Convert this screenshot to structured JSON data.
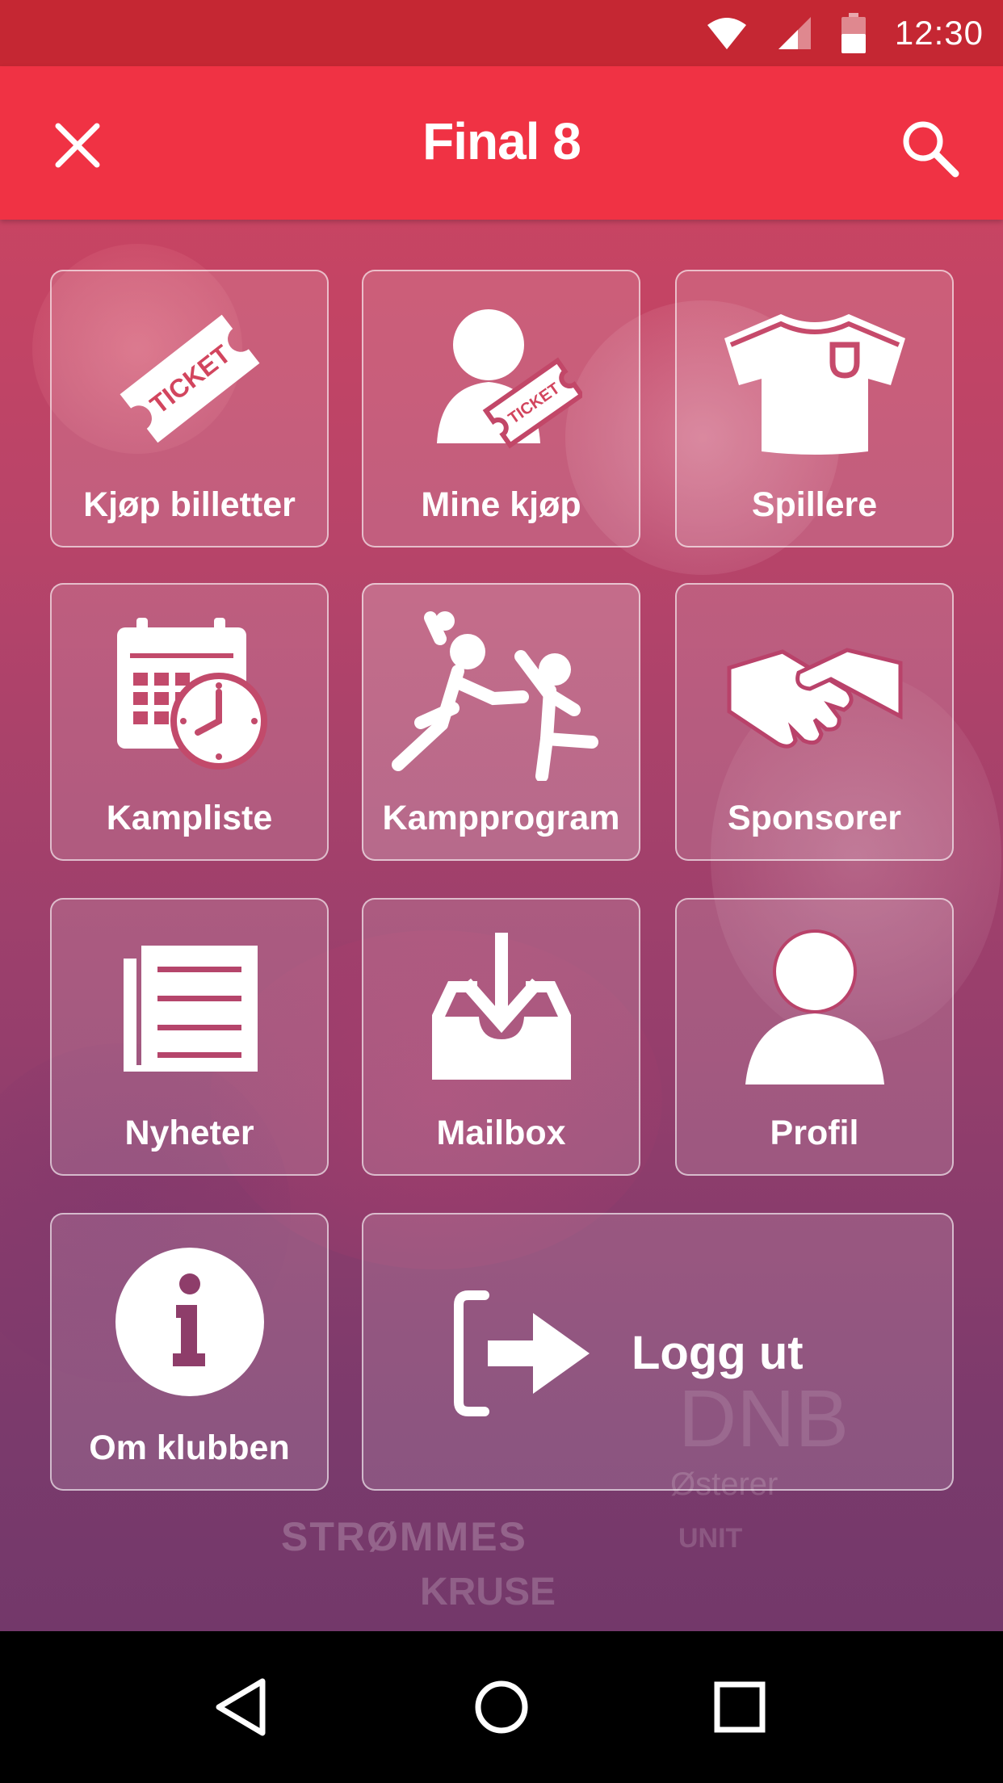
{
  "status_bar": {
    "time": "12:30",
    "icons": [
      "wifi-icon",
      "cellular-signal-icon",
      "battery-icon"
    ]
  },
  "app_bar": {
    "title": "Final 8",
    "close_icon": "close-icon",
    "search_icon": "search-icon"
  },
  "menu": [
    {
      "label": "Kjøp billetter",
      "icon": "ticket-icon",
      "icon_text": "TICKET"
    },
    {
      "label": "Mine kjøp",
      "icon": "user-ticket-icon",
      "icon_text": "TICKET"
    },
    {
      "label": "Spillere",
      "icon": "jersey-icon"
    },
    {
      "label": "Kampliste",
      "icon": "calendar-clock-icon"
    },
    {
      "label": "Kampprogram",
      "icon": "handball-players-icon"
    },
    {
      "label": "Sponsorer",
      "icon": "handshake-icon"
    },
    {
      "label": "Nyheter",
      "icon": "newspaper-icon"
    },
    {
      "label": "Mailbox",
      "icon": "inbox-download-icon"
    },
    {
      "label": "Profil",
      "icon": "person-icon"
    },
    {
      "label": "Om klubben",
      "icon": "info-icon"
    },
    {
      "label": "Logg ut",
      "icon": "logout-icon"
    }
  ],
  "background_text": [
    "STRØMMES",
    "KRUSE",
    "DNB",
    "Østerer",
    "UNIT"
  ],
  "nav_bar": {
    "icons": [
      "back-icon",
      "home-icon",
      "recents-icon"
    ]
  },
  "colors": {
    "status_bar": "#c52733",
    "app_bar": "#f03244",
    "background_top": "#d2455e",
    "background_bottom": "#6d3769",
    "nav_bar": "#000000"
  }
}
